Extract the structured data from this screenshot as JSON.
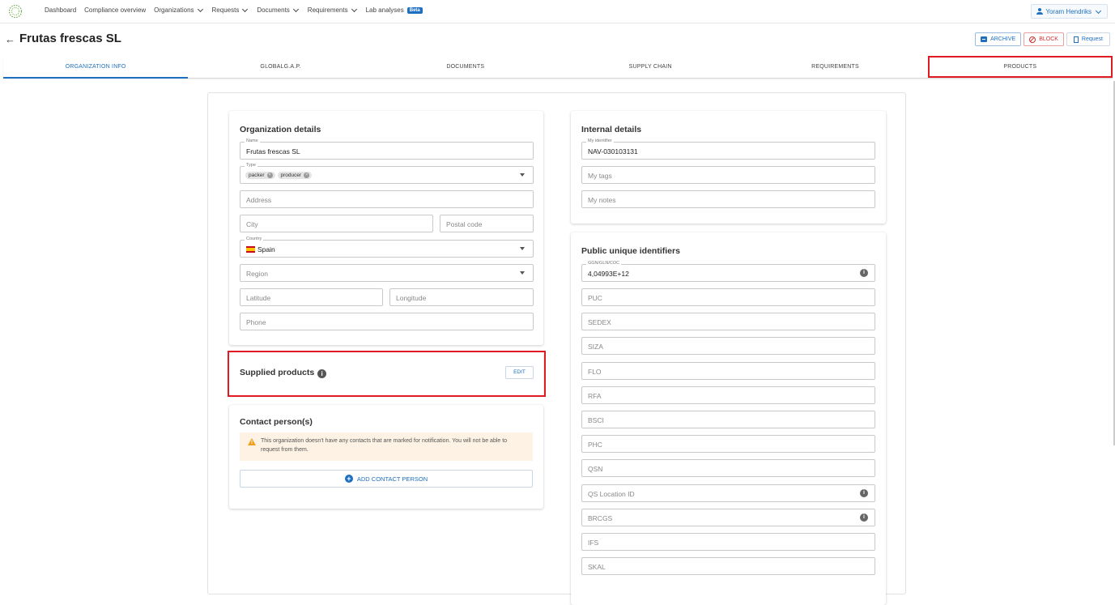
{
  "nav": {
    "items": [
      {
        "label": "Dashboard",
        "dropdown": false
      },
      {
        "label": "Compliance overview",
        "dropdown": false
      },
      {
        "label": "Organizations",
        "dropdown": true
      },
      {
        "label": "Requests",
        "dropdown": true
      },
      {
        "label": "Documents",
        "dropdown": true
      },
      {
        "label": "Requirements",
        "dropdown": true
      },
      {
        "label": "Lab analyses",
        "dropdown": false
      }
    ],
    "beta_label": "Beta",
    "user": "Yoram Hendriks"
  },
  "header": {
    "back_icon": "←",
    "title": "Frutas frescas SL",
    "archive_label": "ARCHIVE",
    "block_label": "BLOCK",
    "request_label": "Request"
  },
  "tabs": [
    "ORGANIZATION INFO",
    "GLOBALG.A.P.",
    "DOCUMENTS",
    "SUPPLY CHAIN",
    "REQUIREMENTS",
    "PRODUCTS"
  ],
  "org_details": {
    "title": "Organization details",
    "name_label": "Name",
    "name_value": "Frutas frescas SL",
    "type_label": "Type",
    "type_chips": [
      "packer",
      "producer"
    ],
    "chip_remove": "×",
    "address_ph": "Address",
    "city_ph": "City",
    "postal_ph": "Postal code",
    "country_label": "Country",
    "country_value": "Spain",
    "region_ph": "Region",
    "latitude_ph": "Latitude",
    "longitude_ph": "Longitude",
    "phone_ph": "Phone"
  },
  "supplied": {
    "title": "Supplied products",
    "info": "i",
    "edit_label": "EDIT"
  },
  "contacts": {
    "title": "Contact person(s)",
    "warning": "This organization doesn't have any contacts that are marked for notification. You will not be able to request from them.",
    "add_label": "ADD CONTACT PERSON",
    "plus": "+"
  },
  "internal": {
    "title": "Internal details",
    "identifier_label": "My identifier",
    "identifier_value": "NAV-030103131",
    "tags_ph": "My tags",
    "notes_ph": "My notes"
  },
  "public_ids": {
    "title": "Public unique identifiers",
    "gln_label": "GGN/GLN/COC",
    "gln_value": "4,04993E+12",
    "info": "i",
    "fields": [
      "PUC",
      "SEDEX",
      "SIZA",
      "FLO",
      "RFA",
      "BSCI",
      "PHC",
      "QSN",
      "QS Location ID",
      "BRCGS",
      "IFS",
      "SKAL"
    ]
  },
  "colors": {
    "accent": "#1e6fbf",
    "highlight": "#e01b24",
    "warning_bg": "#fdf2e3"
  }
}
